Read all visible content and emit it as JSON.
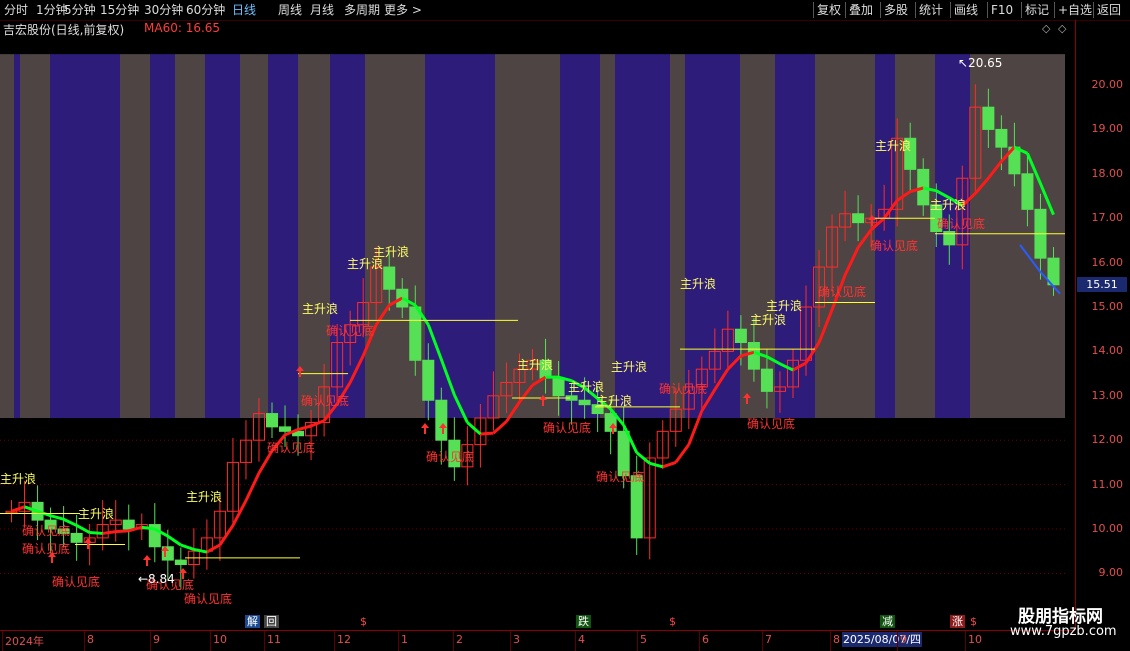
{
  "toolbar": {
    "left": [
      "分时",
      "1分钟",
      "5分钟",
      "15分钟",
      "30分钟",
      "60分钟",
      "日线",
      "周线",
      "月线",
      "多周期",
      "更多 >"
    ],
    "active": "日线",
    "right": [
      "复权",
      "叠加",
      "多股",
      "统计",
      "画线",
      "F10",
      "标记",
      "+自选",
      "返回"
    ]
  },
  "title": {
    "stock": "吉宏股份(日线,前复权)",
    "ma": "MA60: 16.65"
  },
  "colors": {
    "bg": "#000000",
    "up": "#ff2b2b",
    "down": "#55e055",
    "support": "#ffff33",
    "purple": "#2d1c7a",
    "brown": "#4e4443",
    "ma": "#00ff22"
  },
  "yaxis": {
    "ticks": [
      "20.00",
      "19.00",
      "18.00",
      "17.00",
      "16.00",
      "15.00",
      "14.00",
      "13.00",
      "12.00",
      "11.00",
      "10.00",
      "9.00"
    ],
    "last_price": "15.51"
  },
  "annotations": {
    "high": "20.65",
    "low": "8.84",
    "wave": "主升浪",
    "confirm": "确认见底"
  },
  "xaxis": {
    "labels": [
      "2024年",
      "8",
      "9",
      "10",
      "11",
      "12",
      "1",
      "2",
      "3",
      "4",
      "5",
      "6",
      "7",
      "8",
      "9",
      "10"
    ],
    "date": "2025/08/07/四"
  },
  "events": {
    "jie": "解",
    "hui": "回",
    "s": "$",
    "die": "跌",
    "jian": "减",
    "zhang": "涨"
  },
  "watermark": {
    "name": "股朋指标网",
    "url": "www.7gpzb.com"
  },
  "chart_data": {
    "type": "candlestick",
    "symbol": "吉宏股份",
    "period": "日线",
    "ma_label": "MA60",
    "ma_value": 16.65,
    "ylim": [
      8.6,
      20.8
    ],
    "high": 20.65,
    "low": 8.84,
    "last": 15.51,
    "series_close": [
      10.4,
      10.6,
      10.2,
      10.0,
      9.9,
      9.7,
      9.8,
      10.1,
      10.2,
      10.0,
      10.1,
      9.6,
      9.3,
      9.2,
      9.5,
      9.8,
      10.4,
      11.5,
      12.0,
      12.6,
      12.3,
      12.2,
      12.1,
      12.4,
      13.2,
      14.2,
      14.6,
      15.1,
      15.9,
      15.4,
      15.0,
      13.8,
      12.9,
      12.0,
      11.4,
      11.9,
      12.5,
      13.0,
      13.3,
      13.6,
      13.8,
      13.4,
      13.0,
      12.9,
      12.8,
      12.6,
      12.2,
      11.2,
      9.8,
      11.6,
      12.2,
      12.7,
      13.2,
      13.6,
      14.0,
      14.5,
      14.2,
      13.6,
      13.1,
      13.2,
      13.8,
      15.0,
      15.9,
      16.8,
      17.1,
      16.9,
      17.0,
      17.2,
      18.8,
      18.1,
      17.3,
      16.7,
      16.4,
      17.9,
      19.5,
      19.0,
      18.6,
      18.0,
      17.2,
      16.1,
      15.5
    ]
  }
}
